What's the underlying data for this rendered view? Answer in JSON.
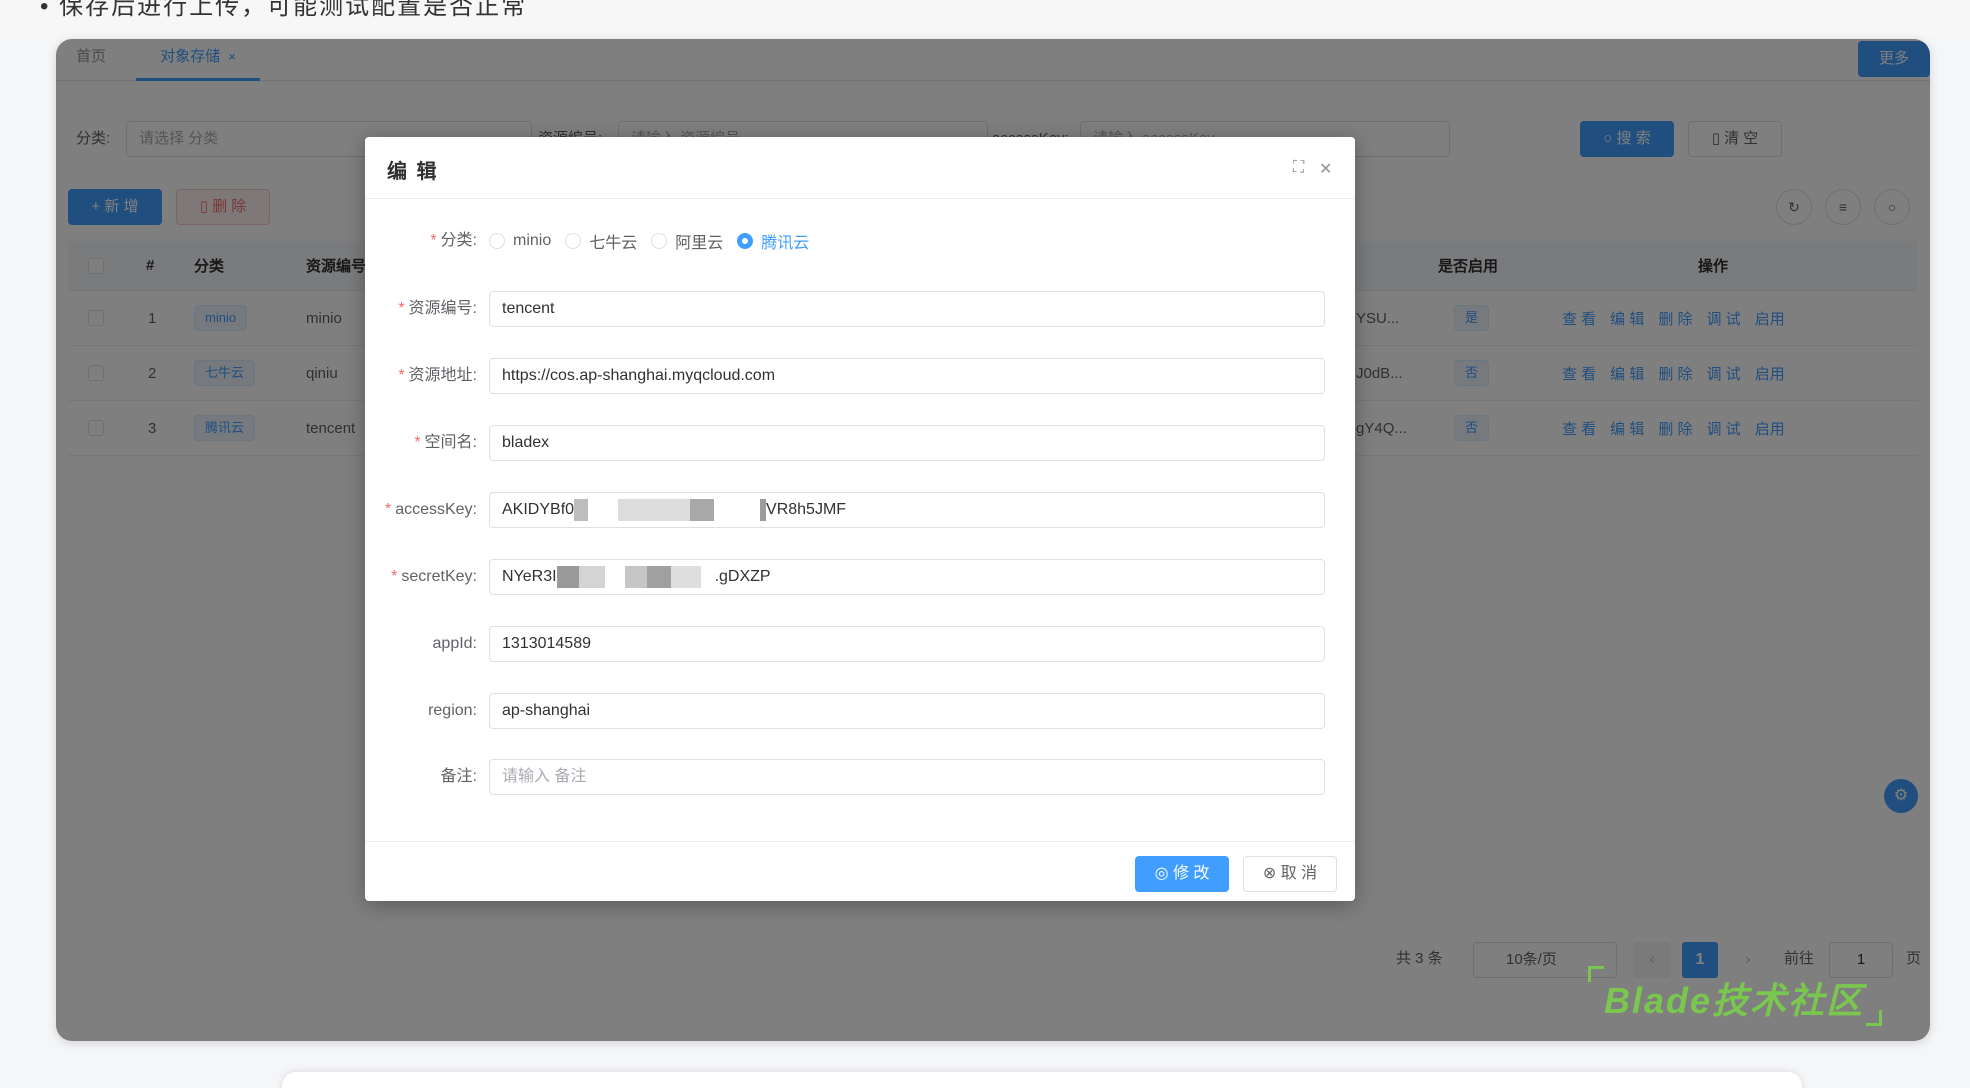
{
  "top_strip": {
    "cut_text": "• 保存后进行上传，可能测试配置是否正常"
  },
  "tabs": {
    "home": "首页",
    "active": "对象存储",
    "close": "×",
    "more": "更多"
  },
  "search": {
    "category_label": "分类:",
    "category_placeholder": "请选择 分类",
    "code_label": "资源编号:",
    "code_placeholder": "请输入 资源编号",
    "accesskey_label": "accessKey:",
    "accesskey_placeholder": "请输入 accessKey",
    "search_btn": "搜 索",
    "clear_btn": "清 空"
  },
  "toolbar": {
    "add_btn": "新 增",
    "delete_btn": "删 除"
  },
  "table": {
    "columns": [
      "#",
      "分类",
      "资源编号",
      "是否启用",
      "操作"
    ],
    "rows": [
      {
        "index": "1",
        "category": "minio",
        "code": "minio",
        "key_frag": "YSU...",
        "enabled": "是"
      },
      {
        "index": "2",
        "category": "七牛云",
        "code": "qiniu",
        "key_frag": "J0dB...",
        "enabled": "否"
      },
      {
        "index": "3",
        "category": "腾讯云",
        "code": "tencent",
        "key_frag": "gY4Q...",
        "enabled": "否"
      }
    ],
    "ops": [
      "查 看",
      "编 辑",
      "删 除",
      "调 试",
      "启用"
    ]
  },
  "pagination": {
    "total": "共 3 条",
    "page_size": "10条/页",
    "current": "1",
    "goto_label": "前往",
    "goto_value": "1",
    "page_unit": "页"
  },
  "dialog": {
    "title": "编 辑",
    "category_label": "分类:",
    "category_options": [
      "minio",
      "七牛云",
      "阿里云",
      "腾讯云"
    ],
    "category_selected": "腾讯云",
    "code_label": "资源编号:",
    "code_value": "tencent",
    "endpoint_label": "资源地址:",
    "endpoint_value": "https://cos.ap-shanghai.myqcloud.com",
    "bucket_label": "空间名:",
    "bucket_value": "bladex",
    "accesskey_label": "accessKey:",
    "accesskey_prefix": "AKIDYBf0",
    "accesskey_suffix": "VR8h5JMF",
    "secretkey_label": "secretKey:",
    "secretkey_prefix": "NYeR3I",
    "secretkey_suffix": ".gDXZP",
    "appid_label": "appId:",
    "appid_value": "1313014589",
    "region_label": "region:",
    "region_value": "ap-shanghai",
    "remark_label": "备注:",
    "remark_placeholder": "请输入 备注",
    "submit_btn": "修 改",
    "cancel_btn": "取 消"
  },
  "watermark": "Blade技术社区",
  "colors": {
    "primary": "#409eff",
    "danger": "#f56c6c",
    "watermark": "#7ac74f"
  }
}
